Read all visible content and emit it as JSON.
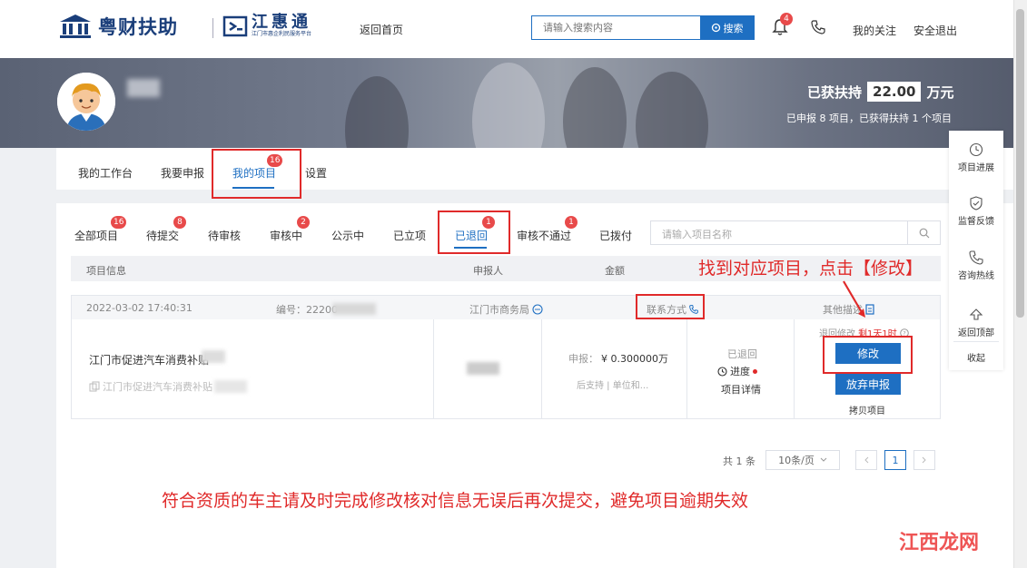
{
  "header": {
    "logo_text": "粤财扶助",
    "logo2_title": "江惠通",
    "logo2_sub": "江门市惠企利民服务平台",
    "back_home": "返回首页",
    "search_placeholder": "请输入搜索内容",
    "search_button": "搜索",
    "bell_count": "4",
    "follow": "我的关注",
    "logout": "安全退出"
  },
  "banner": {
    "got_label": "已获扶持",
    "got_amount": "22.00",
    "got_unit": "万元",
    "summary": "已申报 8 项目，已获得扶持 1 个项目"
  },
  "main_tabs": [
    {
      "label": "我的工作台"
    },
    {
      "label": "我要申报"
    },
    {
      "label": "我的项目",
      "badge": "16"
    },
    {
      "label": "设置"
    }
  ],
  "status_tabs": [
    {
      "label": "全部项目",
      "badge": "16"
    },
    {
      "label": "待提交",
      "badge": "8"
    },
    {
      "label": "待审核"
    },
    {
      "label": "审核中",
      "badge": "2"
    },
    {
      "label": "公示中"
    },
    {
      "label": "已立项"
    },
    {
      "label": "已退回",
      "badge": "1"
    },
    {
      "label": "审核不通过",
      "badge": "1"
    },
    {
      "label": "已拨付"
    }
  ],
  "project_search_placeholder": "请输入项目名称",
  "table_headers": {
    "info": "项目信息",
    "applicant": "申报人",
    "amount": "金额"
  },
  "record": {
    "datetime": "2022-03-02 17:40:31",
    "number_label": "编号：22200",
    "bureau": "江门市商务局",
    "contact": "联系方式",
    "other": "其他描述",
    "title": "江门市促进汽车消费补贴",
    "subtitle": "江门市促进汽车消费补贴",
    "apply_label": "申报：",
    "apply_amount": "¥ 0.300000万",
    "support": "后支持 | 单位和...",
    "status": "已退回",
    "progress": "进度",
    "detail": "项目详情",
    "deadline_label": "退回修改",
    "deadline_value": "剩1天1时",
    "edit": "修改",
    "give_up": "放弃申报",
    "copy": "拷贝项目"
  },
  "pagination": {
    "total": "共 1 条",
    "per_page": "10条/页",
    "current": "1"
  },
  "side_panel": [
    {
      "label": "项目进展",
      "icon": "clock-icon"
    },
    {
      "label": "监督反馈",
      "icon": "shield-icon"
    },
    {
      "label": "咨询热线",
      "icon": "phone-icon"
    },
    {
      "label": "返回顶部",
      "icon": "arrow-up-icon"
    },
    {
      "label": "收起"
    }
  ],
  "annotations": {
    "find_edit": "找到对应项目，点击【修改】",
    "bottom_tip": "符合资质的车主请及时完成修改核对信息无误后再次提交，避免项目逾期失效"
  },
  "watermark": "江西龙网",
  "colors": {
    "primary": "#1e6fc2",
    "badge": "#e84a4a",
    "annotation": "#e02a2a"
  }
}
